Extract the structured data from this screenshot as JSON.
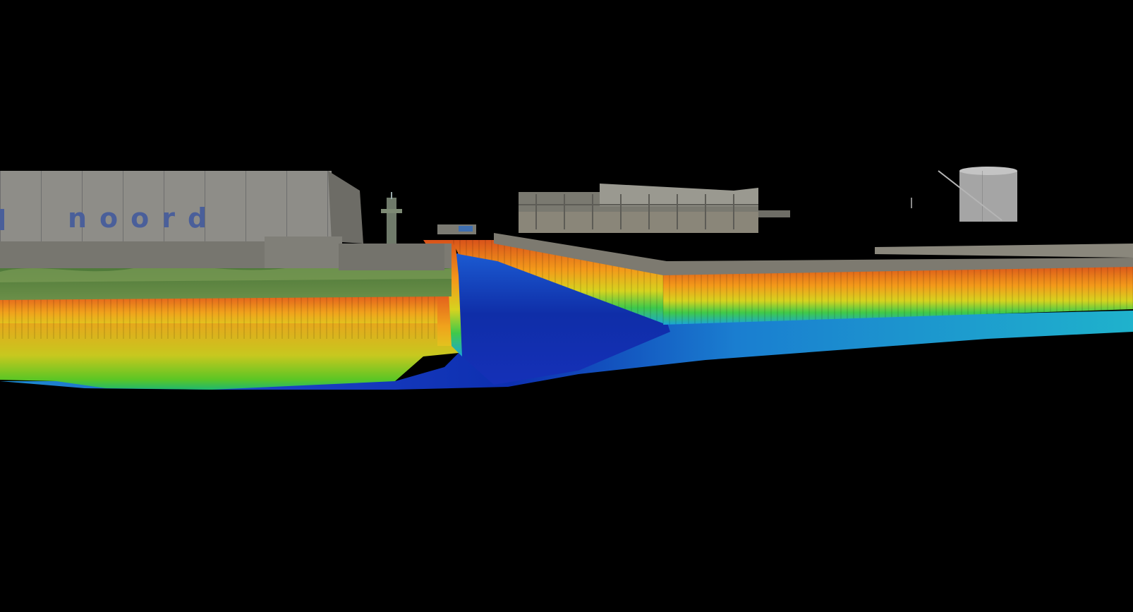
{
  "scene": {
    "sign_text": "noord",
    "background_color": "#000000",
    "colormap": [
      "#0a1a8c",
      "#1f5ad8",
      "#1fa6d8",
      "#1fc47a",
      "#4fd41f",
      "#d8d81f",
      "#f0a01a",
      "#e8601a"
    ]
  }
}
